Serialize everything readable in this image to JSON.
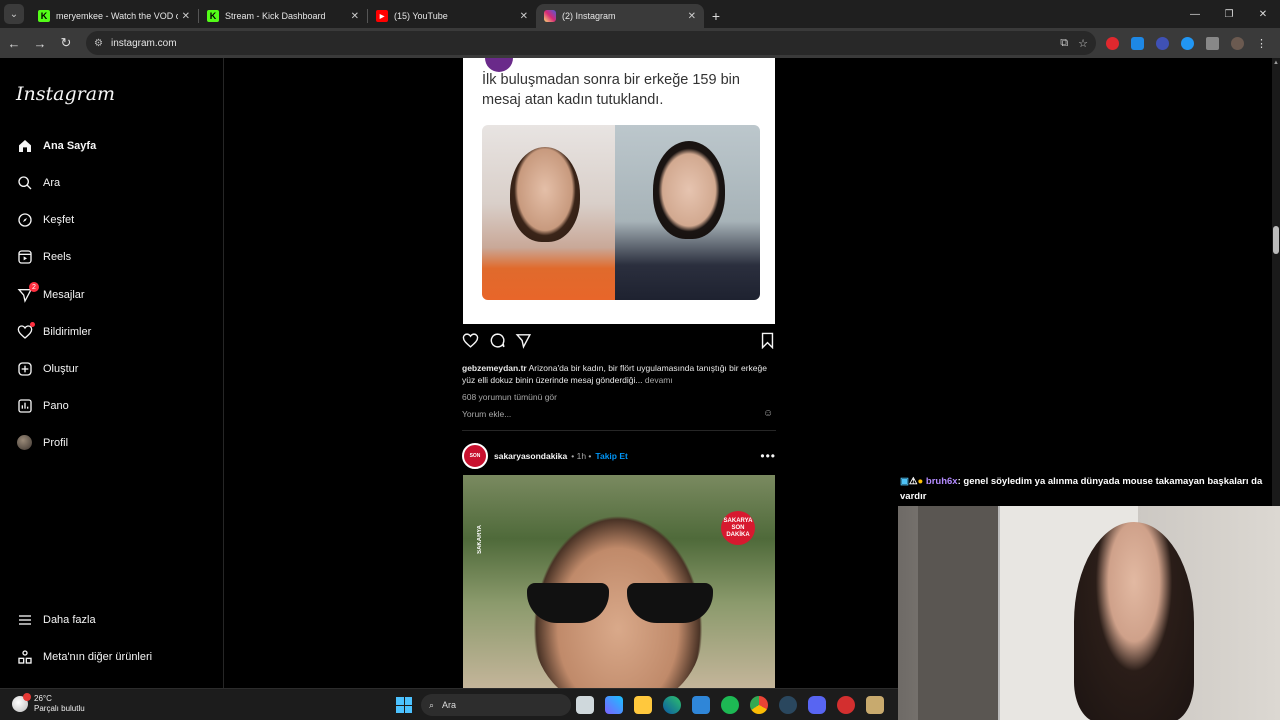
{
  "browser": {
    "tabs": [
      {
        "title": "meryemkee - Watch the VOD o",
        "favicon": "kick-icon",
        "color": "#53fc18",
        "active": false
      },
      {
        "title": "Stream - Kick Dashboard",
        "favicon": "kick-icon",
        "color": "#53fc18",
        "active": false
      },
      {
        "title": "(15) YouTube",
        "favicon": "youtube-icon",
        "color": "#ff0000",
        "active": false
      },
      {
        "title": "(2) Instagram",
        "favicon": "instagram-icon",
        "color": "#d62976",
        "active": true
      }
    ],
    "url": "instagram.com"
  },
  "instagram": {
    "logo": "Instagram",
    "nav": [
      {
        "label": "Ana Sayfa",
        "icon": "home-icon",
        "bold": true
      },
      {
        "label": "Ara",
        "icon": "search-icon"
      },
      {
        "label": "Keşfet",
        "icon": "compass-icon"
      },
      {
        "label": "Reels",
        "icon": "reels-icon"
      },
      {
        "label": "Mesajlar",
        "icon": "messages-icon",
        "badge": "2"
      },
      {
        "label": "Bildirimler",
        "icon": "heart-icon",
        "dot": true
      },
      {
        "label": "Oluştur",
        "icon": "create-icon"
      },
      {
        "label": "Pano",
        "icon": "dashboard-icon"
      },
      {
        "label": "Profil",
        "icon": "avatar"
      }
    ],
    "more": "Daha fazla",
    "meta": "Meta'nın diğer ürünleri"
  },
  "post1": {
    "headline": "İlk buluşmadan sonra bir erkeğe 159 bin mesaj atan kadın tutuklandı.",
    "username": "gebzemeydan.tr",
    "caption": "Arizona'da bir kadın, bir flört uygulamasında tanıştığı bir erkeğe yüz elli dokuz binin üzerinde mesaj gönderdiği...",
    "more": "devamı",
    "comments": "608 yorumun tümünü gör",
    "add_comment": "Yorum ekle..."
  },
  "post2": {
    "username": "sakaryasondakika",
    "time": "1h",
    "follow": "Takip Et",
    "stamp": "SAKARYA SON DAKİKA",
    "side_watermark": "SAKARYA"
  },
  "chat": {
    "username": "bruh6x",
    "message": ": genel söyledim ya alınma dünyada mouse takamayan başkaları da vardır"
  },
  "taskbar": {
    "temp": "26°C",
    "weather": "Parçalı bulutlu",
    "search": "Ara"
  }
}
